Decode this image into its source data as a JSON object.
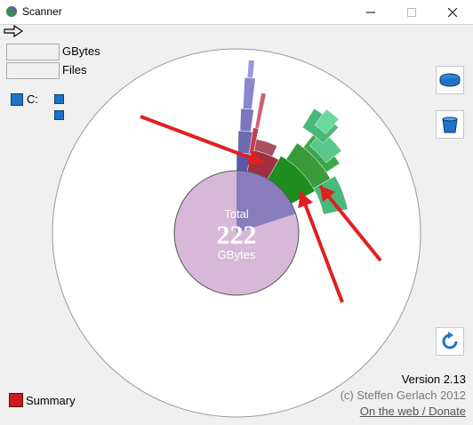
{
  "window": {
    "title": "Scanner"
  },
  "stats": {
    "gbytes_label": "GBytes",
    "files_label": "Files",
    "gbytes_value": "",
    "files_value": ""
  },
  "drive": {
    "label": "C:"
  },
  "center": {
    "total_label": "Total",
    "total_value": "222",
    "unit": "GBytes"
  },
  "footer": {
    "summary_label": "Summary",
    "version": "Version 2.13",
    "copyright": "(c) Steffen Gerlach 2012",
    "link": "On the web / Donate"
  },
  "colors": {
    "pie": "#d8b8d8",
    "blue_segment": "#6e6ab0",
    "green_dark": "#1e8c1e",
    "green_light": "#4ab87a",
    "red_segment": "#a03040",
    "arrow": "#e02020",
    "accent_blue": "#1e73c8"
  }
}
